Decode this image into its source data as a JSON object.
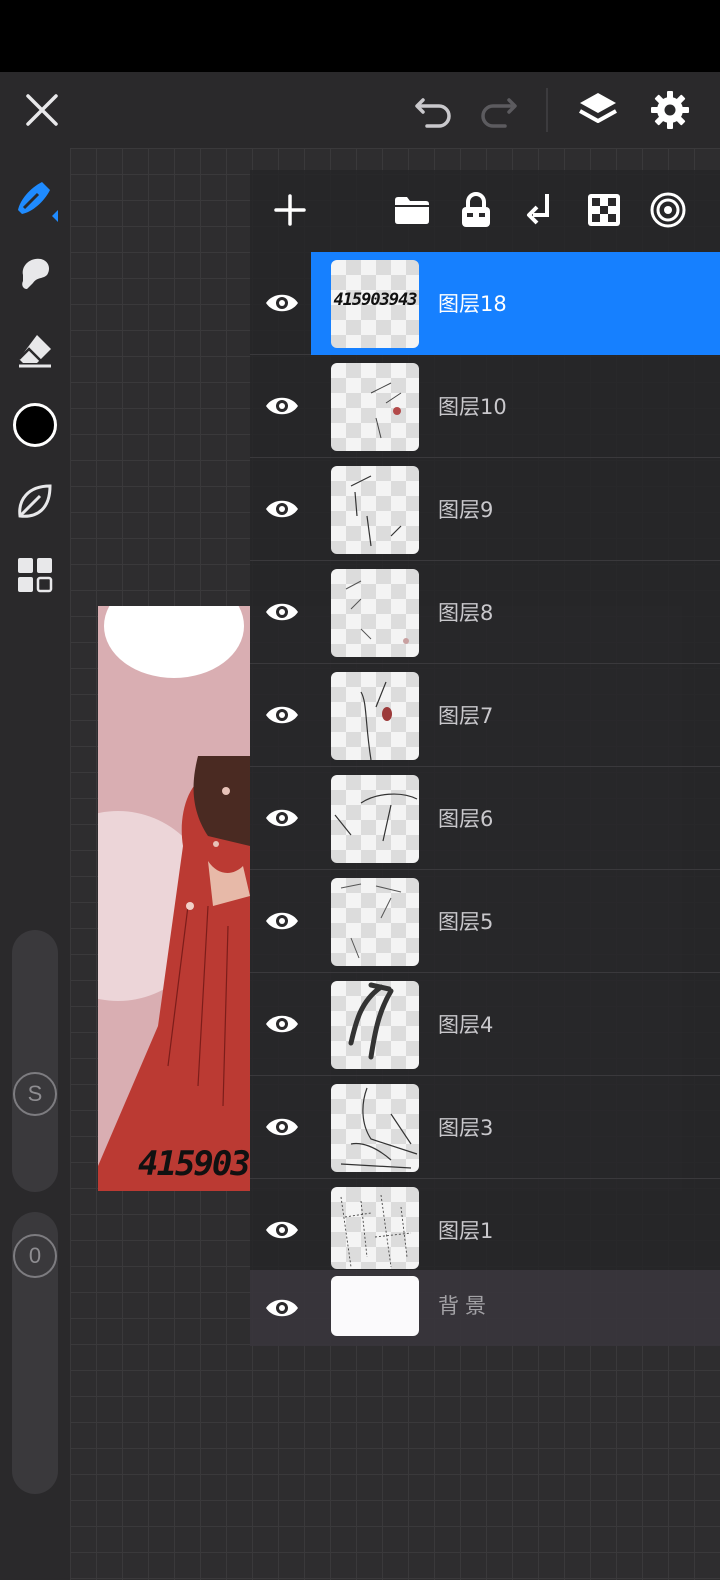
{
  "colors": {
    "accent": "#1680ff",
    "toolbar_bg": "#2a292b",
    "canvas_bg": "#2e2d2f",
    "current_brush_color": "#000000"
  },
  "top_bar": {
    "icons": [
      "close-icon",
      "undo-icon",
      "redo-icon",
      "layers-icon",
      "gear-icon"
    ]
  },
  "left_toolbar": {
    "tools": [
      "brush-icon",
      "smudge-icon",
      "eraser-icon",
      "color-swatch",
      "leaf-icon",
      "grid-icon"
    ],
    "size_slider_label": "S",
    "opacity_slider_label": "0"
  },
  "artwork": {
    "overlay_text": "415903"
  },
  "layers_panel": {
    "actions": [
      "add-icon",
      "folder-icon",
      "lock-icon",
      "merge-down-icon",
      "checkerboard-icon",
      "target-icon"
    ],
    "layers": [
      {
        "name": "图层18",
        "thumb_text": "415903943",
        "selected": true
      },
      {
        "name": "图层10"
      },
      {
        "name": "图层9"
      },
      {
        "name": "图层8"
      },
      {
        "name": "图层7"
      },
      {
        "name": "图层6"
      },
      {
        "name": "图层5"
      },
      {
        "name": "图层4"
      },
      {
        "name": "图层3"
      },
      {
        "name": "图层1"
      }
    ],
    "background_layer": {
      "name": "背景"
    }
  }
}
